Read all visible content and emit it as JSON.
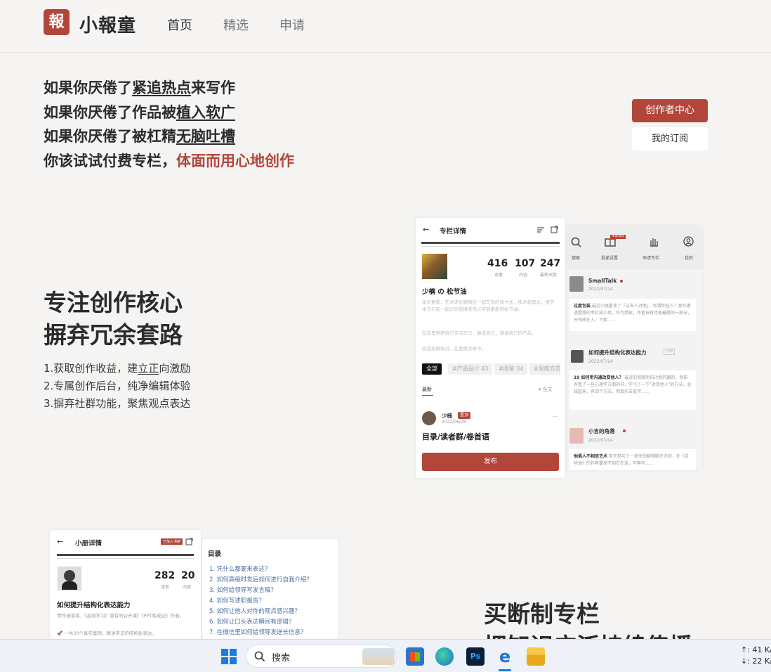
{
  "nav": {
    "logo_mark": "報",
    "logo_text": "小報童",
    "links": [
      "首页",
      "精选",
      "申请"
    ]
  },
  "hero": {
    "line1_prefix": "如果你厌倦了",
    "line1_em": "紧追热点",
    "line1_suffix": "来写作",
    "line2_prefix": "如果你厌倦了作品被",
    "line2_em": "植入软广",
    "line3_prefix": "如果你厌倦了被杠精",
    "line3_em": "无脑吐槽",
    "line4_prefix": "你该试试付费专栏，",
    "line4_em": "体面而用心地创作"
  },
  "buttons": {
    "creator": "创作者中心",
    "subscriptions": "我的订阅"
  },
  "section1": {
    "title_line1": "专注创作核心",
    "title_line2": "摒弃冗余套路",
    "feature1_prefix": "1.获取创作收益，建",
    "feature1_em": "立正",
    "feature1_suffix": "向激励",
    "feature2": "2.专属创作后台，纯净编辑体验",
    "feature3": "3.摒弃社群功能，聚焦观点表达"
  },
  "mock1": {
    "header": "专栏详情",
    "stats": [
      {
        "value": "416",
        "label": "读者"
      },
      {
        "value": "107",
        "label": "内容"
      },
      {
        "value": "247",
        "label": "最新天数"
      }
    ],
    "column_name": "少楠 の 松节油",
    "desc1": "年份更新，艺术评论跟随在一起写完的读书式，技术和理论，用艺术去们在一起讨论前撑来可以买到更新的松节油。",
    "desc2": "在这里帮把自己学习方法，做成自己，调读自己的产品。",
    "desc3": "欢迎加群探讨，在更原文章中。",
    "tags": [
      "全部",
      "#产品设计 43",
      "#图鉴 34",
      "#思维方式"
    ],
    "filter_label": "最新",
    "filter_all": "▾ 全文",
    "post_author": "少楠",
    "post_badge": "置顶",
    "post_date": "2022/06/28",
    "post_title": "目录/读者群/卷首语",
    "publish": "发布"
  },
  "mock2": {
    "tabs": [
      "搜索",
      "投递设置",
      "申请专栏",
      "我的"
    ],
    "tab_badge": "未读消息",
    "items": [
      {
        "name": "SmallTalk",
        "date": "2022/07/14",
        "bold": "过度包装",
        "text": " 最近小强重读了「过去人对他」，何谓你任人？那作者透露想的专栏成小项，作为受家，作者自有持倦着题的一部分，分钟改在入，下期……"
      },
      {
        "name": "如何提升结构化表达能力",
        "badge": "订阅",
        "date": "2022/07/14",
        "bold": "19 如何用沟通改变他人？",
        "text": " 最近的我做听研讨会的跟的，我能有看了一些心理学方面的书，学习了一下\"改变他人\"的方法，总结起来，有四个方法，用真实去拿学……"
      },
      {
        "name": "小言的角落",
        "date": "2022/07/14",
        "bold": "他俱人不相信艺术",
        "text": " 前天参与了一场关的聊得聊许办的，在《这些驰》的作者要来不到在在连，写客写……"
      }
    ]
  },
  "mock3": {
    "header": "小册详情",
    "header_badge": "已加入书架",
    "stats": [
      {
        "value": "282",
        "label": "读者"
      },
      {
        "value": "20",
        "label": "内容"
      }
    ],
    "title": "如何提升结构化表达能力",
    "desc1": "😎作者曾将，《高效学习》曾有的公开课》《PPT炼成记》作者。",
    "desc2": "🚀 一共30个真实案例，精讲常见的结构化表达。"
  },
  "mock4": {
    "title": "目录",
    "items": [
      "1. 凭什么都要来表达？",
      "2. 如何高级时发后如何进行自我介绍？",
      "3. 如何给领导写发言稿？",
      "4. 如何写述职报告？",
      "5. 如何让他人对你的观点感兴趣？",
      "6. 如何让口头表达瞬间有逻辑？",
      "7. 在微信里如何给领导发送长信息？"
    ]
  },
  "section2": {
    "title_line1": "买断制专栏",
    "title_line2": "把知识广泛持续传播"
  },
  "taskbar": {
    "search_placeholder": "搜索",
    "net_up": "↑: 41 K/",
    "net_down": "↓: 22 K/"
  },
  "colors": {
    "accent": "#b2463b",
    "background": "#f5f4f2",
    "text": "#2b2b2b"
  }
}
